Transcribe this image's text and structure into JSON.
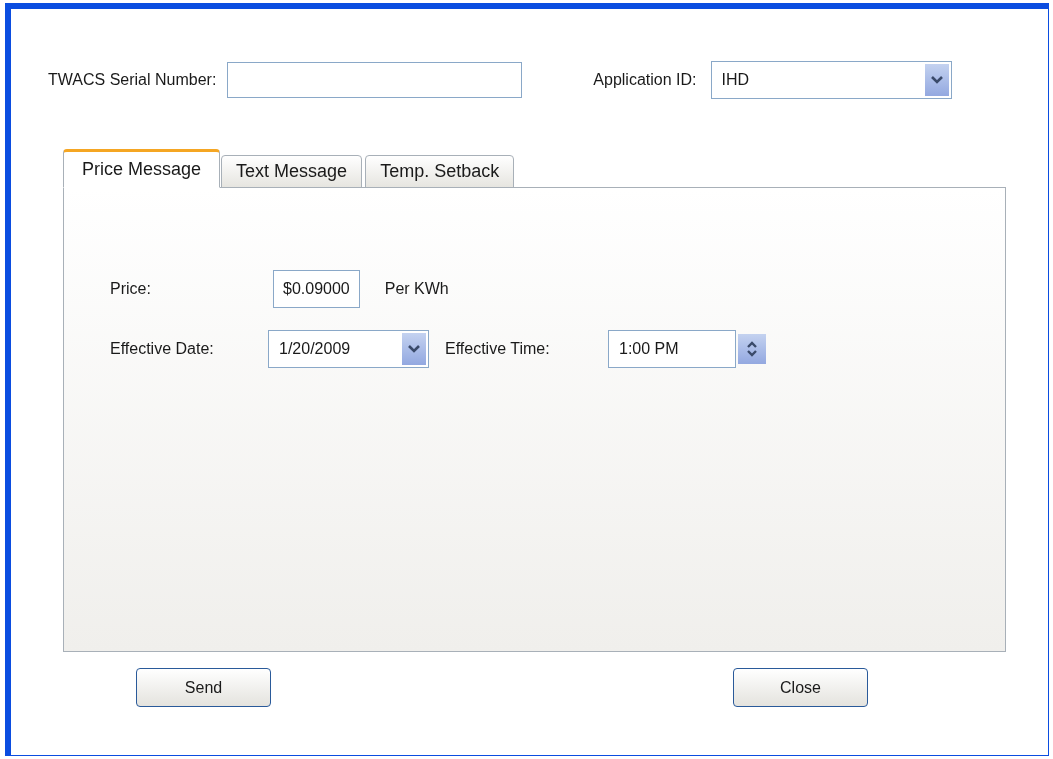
{
  "header_fields": [
    {
      "kind": "text",
      "label": "TWACS Serial Number:"
    },
    {
      "kind": "dropdown",
      "label": "Application ID:",
      "value": "IHD"
    }
  ],
  "tabs": [
    {
      "label": "Price Message",
      "selected": true
    },
    {
      "label": "Text Message",
      "selected": false
    },
    {
      "label": "Temp. Setback",
      "selected": false
    }
  ],
  "price": {
    "label": "Price:",
    "value": "$0.09000",
    "unit": "Per KWh"
  },
  "effective_date": {
    "label": "Effective Date:",
    "value": "1/20/2009"
  },
  "effective_time": {
    "label": "Effective Time:",
    "value": "1:00 PM"
  },
  "buttons": [
    "Send",
    "Close"
  ]
}
